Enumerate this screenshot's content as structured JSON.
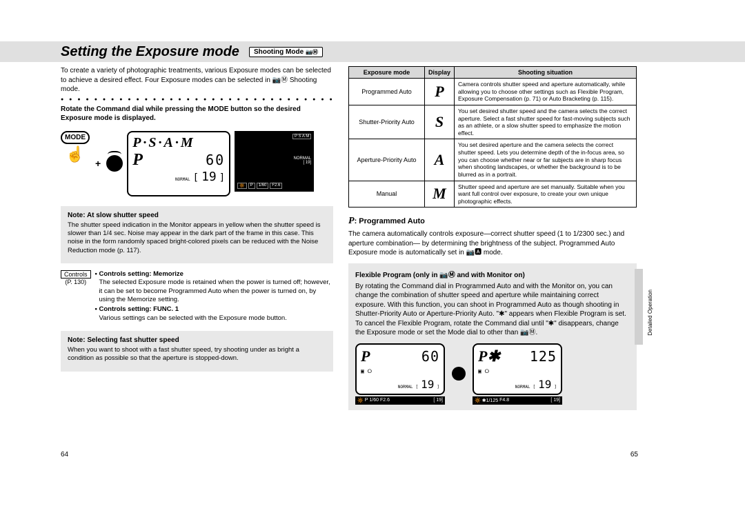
{
  "title": "Setting the Exposure mode",
  "title_tag": "Shooting Mode",
  "title_tag_icon": "📷Ⓜ",
  "left": {
    "intro": "To create a variety of photographic treatments, various Exposure modes can be selected to achieve a desired effect. Four Exposure modes can be selected in 📷Ⓜ Shooting mode.",
    "instruction": "Rotate the Command dial while pressing the MODE button so the desired Exposure mode is displayed.",
    "mode_button": "MODE",
    "lcd_top": "P·S·A·M",
    "lcd_p": "P",
    "lcd_speed": "60",
    "lcd_normal": "NORMAL",
    "lcd_count": "19",
    "monitor_psam": "P S A M",
    "monitor_bar": [
      "🔆",
      "P",
      "1/60",
      "F2.6"
    ],
    "monitor_right": [
      "NORMAL",
      "[    19]"
    ],
    "note1_title": "Note: At slow shutter speed",
    "note1_body": "The shutter speed indication in the Monitor appears in yellow when the shutter speed is slower than 1/4 sec. Noise may appear in the dark part of the frame in this case. This noise in the form randomly spaced bright-colored pixels can be reduced with the Noise Reduction mode (p. 117).",
    "controls_label": "Controls",
    "controls_ref": "(P. 130)",
    "controls_items": [
      {
        "bold": "• Controls setting: Memorize",
        "text": "The selected Exposure mode is retained when the power is turned off; however, it can be set to become Programmed Auto when the power is turned on, by using the Memorize setting."
      },
      {
        "bold": "• Controls setting: FUNC. 1",
        "text": "Various settings can be selected with the Exposure mode button."
      }
    ],
    "note2_title": "Note: Selecting fast shutter speed",
    "note2_body": "When you want to shoot with a fast shutter speed, try shooting under as bright a condition as possible so that the aperture is stopped-down."
  },
  "table": {
    "headers": [
      "Exposure mode",
      "Display",
      "Shooting situation"
    ],
    "rows": [
      {
        "mode": "Programmed Auto",
        "disp": "P",
        "sit": "Camera controls shutter speed and aperture automatically, while allowing you to choose other settings such as Flexible Program, Exposure Compensation (p. 71) or Auto Bracketing (p. 115)."
      },
      {
        "mode": "Shutter-Priority Auto",
        "disp": "S",
        "sit": "You set desired shutter speed and the camera selects the correct aperture. Select a fast shutter speed for fast-moving subjects such as an athlete, or a slow shutter speed to emphasize the motion effect."
      },
      {
        "mode": "Aperture-Priority Auto",
        "disp": "A",
        "sit": "You set desired aperture and the camera selects the correct shutter speed. Lets you determine depth of the in-focus area, so you can choose whether near or far subjects are in sharp focus when shooting landscapes, or whether the background is to be blurred as in a portrait."
      },
      {
        "mode": "Manual",
        "disp": "M",
        "sit": "Shutter speed and aperture are set manually. Suitable when you want full control over exposure, to create your own unique photographic effects."
      }
    ]
  },
  "right": {
    "prog_heading_icon": "P",
    "prog_heading": ": Programmed Auto",
    "prog_body": "The camera automatically controls exposure—correct shutter speed (1 to 1/2300 sec.) and aperture combination— by determining the brightness of the subject. Programmed Auto Exposure mode is automatically set in 📷🅰 mode.",
    "flex_title": "Flexible Program (only in 📷Ⓜ and with Monitor on)",
    "flex_body": "By rotating the Command dial in Programmed Auto and with the Monitor on, you can change the combination of shutter speed and aperture while maintaining correct exposure. With this function, you can shoot in Programmed Auto as though shooting in Shutter-Priority Auto or Aperture-Priority Auto. \"✱\" appears when Flexible Program is set. To cancel the Flexible Program, rotate the Command dial until \"✱\" disappears, change the Exposure mode or set the Mode dial to other than 📷Ⓜ.",
    "lcdA": {
      "p": "P",
      "spd": "60",
      "norm": "NORMAL",
      "cnt": "19",
      "bar": [
        "🔆",
        "P",
        "1/60",
        "F2.6",
        "[   19]"
      ]
    },
    "lcdB": {
      "p": "P✱",
      "spd": "125",
      "norm": "NORMAL",
      "cnt": "19",
      "bar": [
        "🔆",
        "✱1/125",
        "F4.8",
        "[   19]"
      ]
    }
  },
  "side_label": "Detailed Operation",
  "page_left": "64",
  "page_right": "65"
}
